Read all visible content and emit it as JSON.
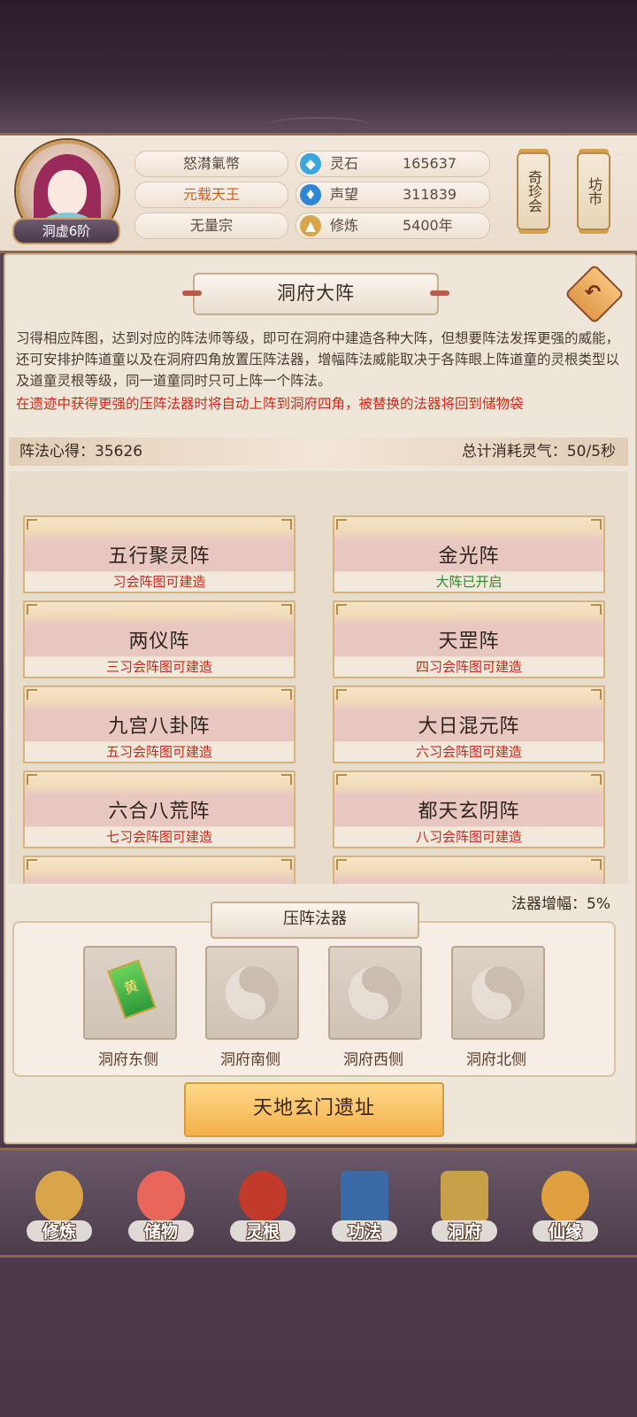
{
  "header": {
    "player_name": "怒潸氭幣",
    "player_title": "元载天王",
    "sect": "无量宗",
    "rank": "洞虚6阶",
    "resources": [
      {
        "icon": "spirit-stone-icon",
        "label": "灵石",
        "value": "165637"
      },
      {
        "icon": "reputation-icon",
        "label": "声望",
        "value": "311839"
      },
      {
        "icon": "cultivation-icon",
        "label": "修炼",
        "value": "5400年"
      }
    ],
    "side_buttons": [
      {
        "label": "奇珍会"
      },
      {
        "label": "坊市"
      }
    ]
  },
  "page": {
    "title": "洞府大阵",
    "description": "习得相应阵图，达到对应的阵法师等级，即可在洞府中建造各种大阵，但想要阵法发挥更强的威能，还可安排护阵道童以及在洞府四角放置压阵法器，增幅阵法威能取决于各阵眼上阵道童的灵根类型以及道童灵根等级，同一道童同时只可上阵一个阵法。",
    "warning": "在遗迹中获得更强的压阵法器时将自动上阵到洞府四角，被替换的法器将回到储物袋",
    "formation_insight": "阵法心得：35626",
    "total_consumption": "总计消耗灵气：50/5秒"
  },
  "formations": [
    {
      "name": "五行聚灵阵",
      "status": "习会阵图可建造",
      "open": false
    },
    {
      "name": "金光阵",
      "status": "大阵已开启",
      "open": true
    },
    {
      "name": "两仪阵",
      "status": "三习会阵图可建造",
      "open": false
    },
    {
      "name": "天罡阵",
      "status": "四习会阵图可建造",
      "open": false
    },
    {
      "name": "九宫八卦阵",
      "status": "五习会阵图可建造",
      "open": false
    },
    {
      "name": "大日混元阵",
      "status": "六习会阵图可建造",
      "open": false
    },
    {
      "name": "六合八荒阵",
      "status": "七习会阵图可建造",
      "open": false
    },
    {
      "name": "都天玄阴阵",
      "status": "八习会阵图可建造",
      "open": false
    }
  ],
  "artifacts": {
    "title": "压阵法器",
    "amplify": "法器增幅：5%",
    "slots": [
      {
        "label": "洞府东侧",
        "filled": true,
        "item_glyph": "黄"
      },
      {
        "label": "洞府南侧",
        "filled": false
      },
      {
        "label": "洞府西侧",
        "filled": false
      },
      {
        "label": "洞府北侧",
        "filled": false
      }
    ],
    "ruins_button": "天地玄门遗址"
  },
  "nav": [
    {
      "label": "修炼",
      "icon": "cultivation-nav-icon",
      "color": "#d9a54a"
    },
    {
      "label": "储物",
      "icon": "storage-bag-icon",
      "color": "#e8665a"
    },
    {
      "label": "灵根",
      "icon": "spirit-root-icon",
      "color": "#c23a2a"
    },
    {
      "label": "功法",
      "icon": "technique-book-icon",
      "color": "#3a6aa8"
    },
    {
      "label": "洞府",
      "icon": "cave-mansion-icon",
      "color": "#c9a04a"
    },
    {
      "label": "仙缘",
      "icon": "immortal-fate-icon",
      "color": "#e0a040"
    }
  ],
  "colors": {
    "accent_red": "#d0281a",
    "open_green": "#2f8a2a",
    "title_orange": "#d0601a"
  }
}
